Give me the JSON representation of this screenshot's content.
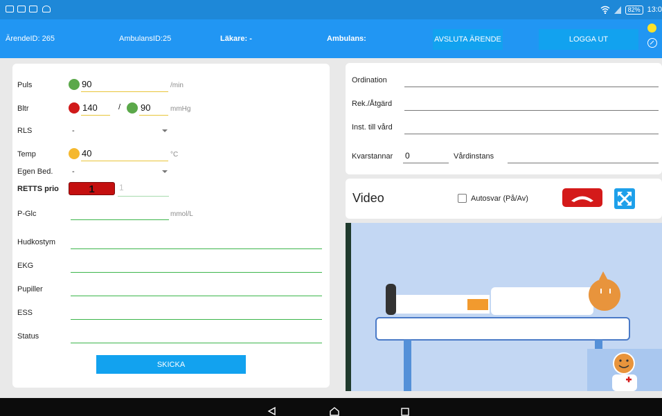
{
  "statusbar": {
    "time": "13:0",
    "battery": "82%"
  },
  "header": {
    "arende_id": "ÄrendeID: 265",
    "ambulans_id": "AmbulansID:25",
    "lakare": "Läkare: -",
    "ambulans": "Ambulans:",
    "avsluta_label": "AVSLUTA ÄRENDE",
    "logga_ut_label": "LOGGA UT"
  },
  "vitals": {
    "puls_label": "Puls",
    "puls_value": "90",
    "puls_unit": "/min",
    "bltr_label": "Bltr",
    "bltr_sys": "140",
    "bltr_sep": "/",
    "bltr_dia": "90",
    "bltr_unit": "mmHg",
    "rls_label": "RLS",
    "rls_value": "-",
    "temp_label": "Temp",
    "temp_value": "40",
    "temp_unit": "°C",
    "egen_bed_label": "Egen Bed.",
    "egen_bed_value": "-",
    "retts_label": "RETTS prio",
    "retts_value": "1",
    "retts_hint": "1",
    "pglc_label": "P-Glc",
    "pglc_unit": "mmol/L",
    "hudkostym_label": "Hudkostym",
    "ekg_label": "EKG",
    "pupiller_label": "Pupiller",
    "ess_label": "ESS",
    "status_label": "Status",
    "skicka_label": "SKICKA"
  },
  "colors": {
    "header": "#2196f3",
    "button": "#12a2ef",
    "green": "#5ba84a",
    "red": "#d01919",
    "yellow": "#f5b82e",
    "retts_red": "#c40f0f"
  },
  "orders": {
    "ordination_label": "Ordination",
    "rek_label": "Rek./Åtgärd",
    "inst_label": "Inst. till vård",
    "kvarstannar_label": "Kvarstannar",
    "kvarstannar_value": "0",
    "vardinstans_label": "Vårdinstans"
  },
  "video": {
    "title": "Video",
    "autosvar_label": "Autosvar (På/Av)",
    "hangup_icon": "phone-hangup-icon",
    "expand_icon": "expand-icon"
  }
}
